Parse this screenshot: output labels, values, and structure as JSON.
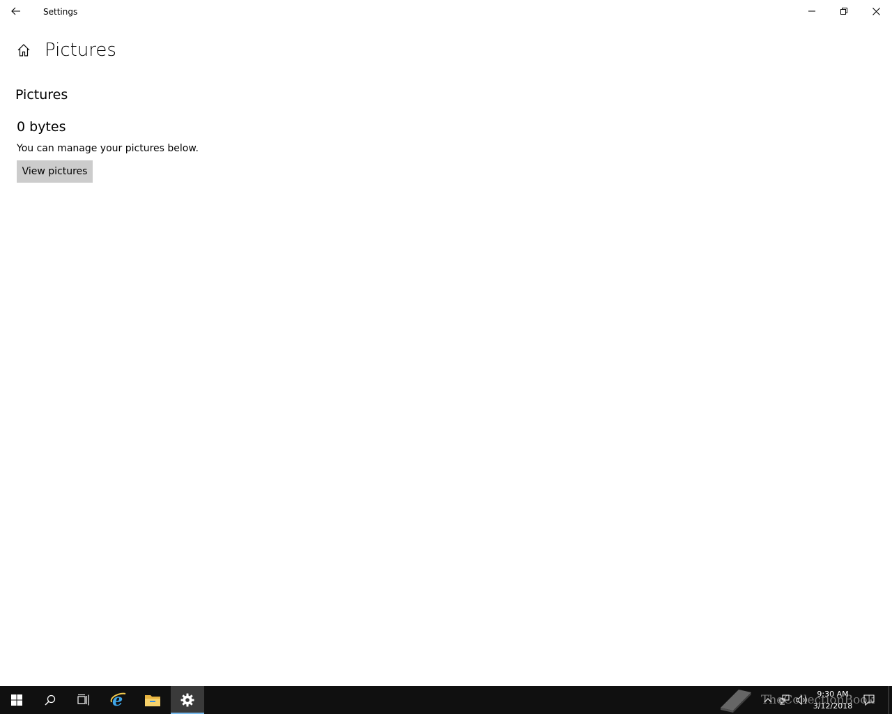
{
  "window": {
    "title": "Settings"
  },
  "page": {
    "title": "Pictures",
    "section_title": "Pictures",
    "size": "0 bytes",
    "description": "You can manage your pictures below.",
    "view_button_label": "View pictures"
  },
  "taskbar": {
    "pinned": [
      {
        "name": "start",
        "icon": "windows-logo-icon"
      },
      {
        "name": "search",
        "icon": "search-icon"
      },
      {
        "name": "task-view",
        "icon": "task-view-icon"
      },
      {
        "name": "internet-explorer",
        "icon": "internet-explorer-icon"
      },
      {
        "name": "file-explorer",
        "icon": "folder-icon"
      },
      {
        "name": "settings",
        "icon": "gear-icon",
        "active": true
      }
    ],
    "watermark": "TheCollectionBook",
    "clock": {
      "time": "9:30 AM",
      "date": "3/12/2018"
    }
  },
  "colors": {
    "window_bg": "#ffffff",
    "button_bg": "#cccccc",
    "taskbar_bg": "#101010",
    "taskbar_active": "#3a3a3a",
    "accent": "#76b9ed"
  }
}
